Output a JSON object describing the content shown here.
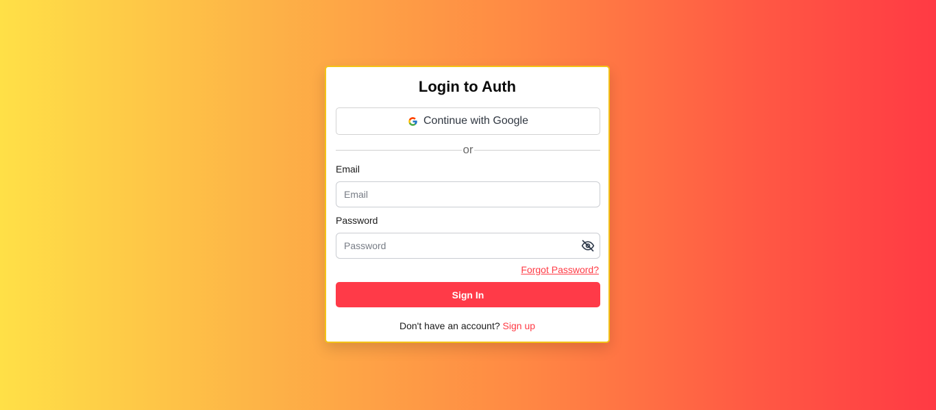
{
  "login": {
    "title": "Login to Auth",
    "google_button_label": "Continue with Google",
    "divider_text": "or",
    "email_label": "Email",
    "email_placeholder": "Email",
    "email_value": "",
    "password_label": "Password",
    "password_placeholder": "Password",
    "password_value": "",
    "forgot_password_label": "Forgot Password?",
    "sign_in_label": "Sign In",
    "no_account_text": "Don't have an account?",
    "sign_up_label": "Sign up"
  },
  "icons": {
    "google": "google-icon",
    "password_toggle": "eye-off-icon"
  },
  "colors": {
    "accent": "#ff3a48",
    "card_border": "#f3c316",
    "gradient_start": "#ffe047",
    "gradient_end": "#ff3a44"
  }
}
